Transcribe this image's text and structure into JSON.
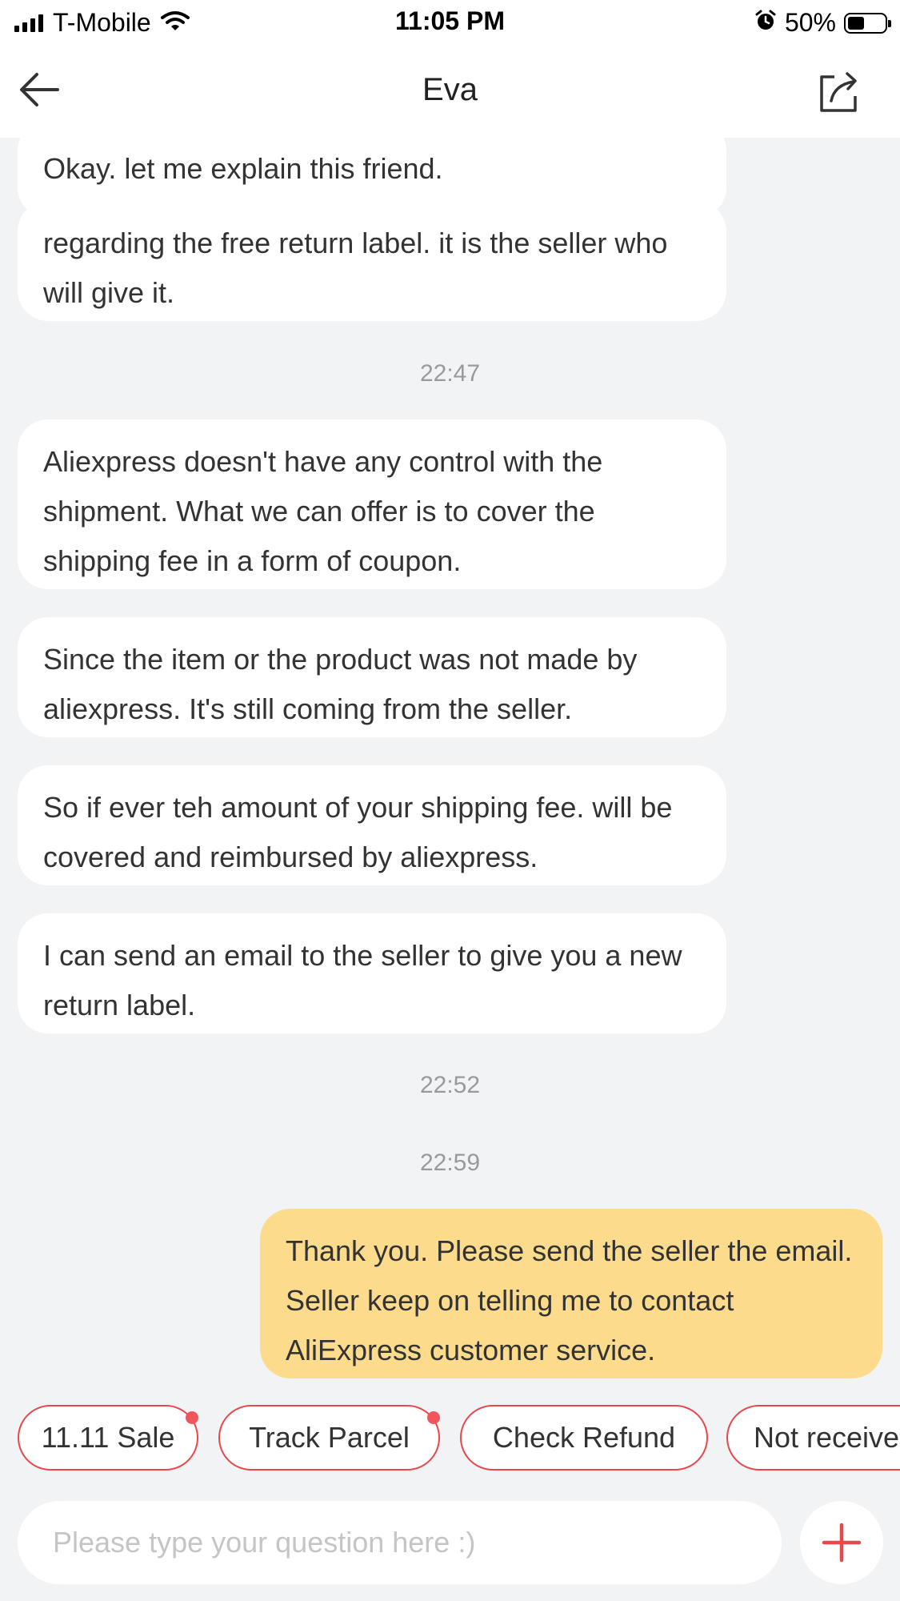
{
  "status_bar": {
    "carrier": "T-Mobile",
    "time": "11:05 PM",
    "battery": "50%"
  },
  "header": {
    "title": "Eva"
  },
  "messages": {
    "m0": "Okay. let me explain this friend.",
    "m1": "regarding the free return label. it is the seller who will give it.",
    "t1": "22:47",
    "m2": "Aliexpress doesn't have any control with the shipment. What we can offer is to cover the shipping fee in a form of coupon.",
    "m3": "Since the item or the product was not made by aliexpress. It's still coming from the seller.",
    "m4": "So if ever teh amount of your shipping fee. will be covered and reimbursed by aliexpress.",
    "m5": "I can send an email to the seller to give you a new return label.",
    "t2": "22:52",
    "t3": "22:59",
    "m6": "Thank you. Please send the seller the email. Seller keep on telling me to contact AliExpress customer service."
  },
  "quick_replies": [
    "11.11 Sale",
    "Track Parcel",
    "Check Refund",
    "Not received"
  ],
  "input": {
    "placeholder": "Please type your question here :)"
  },
  "colors": {
    "accent": "#e8474c",
    "user_bubble": "#fcdc8c",
    "background": "#f2f3f5"
  },
  "icons": [
    "signal-icon",
    "wifi-icon",
    "alarm-icon",
    "battery-icon",
    "back-arrow-icon",
    "share-icon",
    "plus-icon"
  ]
}
